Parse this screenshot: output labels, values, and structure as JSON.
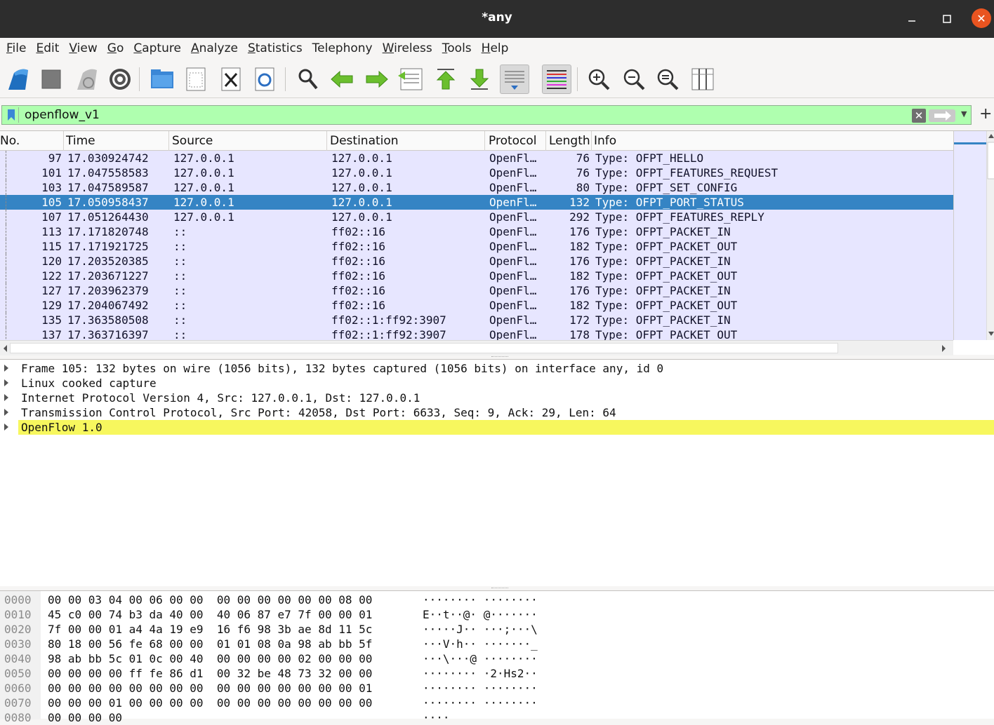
{
  "window": {
    "title": "*any",
    "min_icon": "minimize-icon",
    "max_icon": "maximize-icon",
    "close_icon": "close-icon"
  },
  "menu": [
    {
      "label": "File",
      "u": "F",
      "rest": "ile"
    },
    {
      "label": "Edit",
      "u": "E",
      "rest": "dit"
    },
    {
      "label": "View",
      "u": "V",
      "rest": "iew"
    },
    {
      "label": "Go",
      "u": "G",
      "rest": "o"
    },
    {
      "label": "Capture",
      "u": "C",
      "rest": "apture"
    },
    {
      "label": "Analyze",
      "u": "A",
      "rest": "nalyze"
    },
    {
      "label": "Statistics",
      "u": "S",
      "rest": "tatistics"
    },
    {
      "label": "Telephony",
      "u": "",
      "rest": "Telephony"
    },
    {
      "label": "Wireless",
      "u": "W",
      "rest": "ireless"
    },
    {
      "label": "Tools",
      "u": "T",
      "rest": "ools"
    },
    {
      "label": "Help",
      "u": "H",
      "rest": "elp"
    }
  ],
  "toolbar": [
    "start-capture-icon",
    "stop-capture-icon",
    "restart-capture-icon",
    "capture-options-icon",
    "open-file-icon",
    "save-file-icon",
    "close-file-icon",
    "reload-file-icon",
    "find-packet-icon",
    "go-back-icon",
    "go-forward-icon",
    "go-to-packet-icon",
    "first-packet-icon",
    "last-packet-icon",
    "autoscroll-icon",
    "colorize-icon",
    "zoom-in-icon",
    "zoom-out-icon",
    "normal-size-icon",
    "resize-columns-icon"
  ],
  "filter": {
    "value": "openflow_v1",
    "clear_icon": "clear-filter-icon",
    "apply_icon": "apply-filter-icon",
    "add_label": "+"
  },
  "columns": [
    "No.",
    "Time",
    "Source",
    "Destination",
    "Protocol",
    "Length",
    "Info"
  ],
  "packets": [
    {
      "no": "97",
      "time": "17.030924742",
      "src": "127.0.0.1",
      "dst": "127.0.0.1",
      "proto": "OpenFl…",
      "len": "76",
      "info": "Type: OFPT_HELLO",
      "selected": false
    },
    {
      "no": "101",
      "time": "17.047558583",
      "src": "127.0.0.1",
      "dst": "127.0.0.1",
      "proto": "OpenFl…",
      "len": "76",
      "info": "Type: OFPT_FEATURES_REQUEST",
      "selected": false
    },
    {
      "no": "103",
      "time": "17.047589587",
      "src": "127.0.0.1",
      "dst": "127.0.0.1",
      "proto": "OpenFl…",
      "len": "80",
      "info": "Type: OFPT_SET_CONFIG",
      "selected": false
    },
    {
      "no": "105",
      "time": "17.050958437",
      "src": "127.0.0.1",
      "dst": "127.0.0.1",
      "proto": "OpenFl…",
      "len": "132",
      "info": "Type: OFPT_PORT_STATUS",
      "selected": true
    },
    {
      "no": "107",
      "time": "17.051264430",
      "src": "127.0.0.1",
      "dst": "127.0.0.1",
      "proto": "OpenFl…",
      "len": "292",
      "info": "Type: OFPT_FEATURES_REPLY",
      "selected": false
    },
    {
      "no": "113",
      "time": "17.171820748",
      "src": "::",
      "dst": "ff02::16",
      "proto": "OpenFl…",
      "len": "176",
      "info": "Type: OFPT_PACKET_IN",
      "selected": false
    },
    {
      "no": "115",
      "time": "17.171921725",
      "src": "::",
      "dst": "ff02::16",
      "proto": "OpenFl…",
      "len": "182",
      "info": "Type: OFPT_PACKET_OUT",
      "selected": false
    },
    {
      "no": "120",
      "time": "17.203520385",
      "src": "::",
      "dst": "ff02::16",
      "proto": "OpenFl…",
      "len": "176",
      "info": "Type: OFPT_PACKET_IN",
      "selected": false
    },
    {
      "no": "122",
      "time": "17.203671227",
      "src": "::",
      "dst": "ff02::16",
      "proto": "OpenFl…",
      "len": "182",
      "info": "Type: OFPT_PACKET_OUT",
      "selected": false
    },
    {
      "no": "127",
      "time": "17.203962379",
      "src": "::",
      "dst": "ff02::16",
      "proto": "OpenFl…",
      "len": "176",
      "info": "Type: OFPT_PACKET_IN",
      "selected": false
    },
    {
      "no": "129",
      "time": "17.204067492",
      "src": "::",
      "dst": "ff02::16",
      "proto": "OpenFl…",
      "len": "182",
      "info": "Type: OFPT_PACKET_OUT",
      "selected": false
    },
    {
      "no": "135",
      "time": "17.363580508",
      "src": "::",
      "dst": "ff02::1:ff92:3907",
      "proto": "OpenFl…",
      "len": "172",
      "info": "Type: OFPT_PACKET_IN",
      "selected": false
    },
    {
      "no": "137",
      "time": "17.363716397",
      "src": "::",
      "dst": "ff02::1:ff92:3907",
      "proto": "OpenFl…",
      "len": "178",
      "info": "Type: OFPT_PACKET_OUT",
      "selected": false
    }
  ],
  "details": [
    {
      "text": "Frame 105: 132 bytes on wire (1056 bits), 132 bytes captured (1056 bits) on interface any, id 0",
      "highlight": false
    },
    {
      "text": "Linux cooked capture",
      "highlight": false
    },
    {
      "text": "Internet Protocol Version 4, Src: 127.0.0.1, Dst: 127.0.0.1",
      "highlight": false
    },
    {
      "text": "Transmission Control Protocol, Src Port: 42058, Dst Port: 6633, Seq: 9, Ack: 29, Len: 64",
      "highlight": false
    },
    {
      "text": "OpenFlow 1.0",
      "highlight": true
    }
  ],
  "bytes": [
    {
      "off": "0000",
      "hex": "00 00 03 04 00 06 00 00  00 00 00 00 00 00 08 00",
      "ascii": "········ ········"
    },
    {
      "off": "0010",
      "hex": "45 c0 00 74 b3 da 40 00  40 06 87 e7 7f 00 00 01",
      "ascii": "E··t··@· @·······"
    },
    {
      "off": "0020",
      "hex": "7f 00 00 01 a4 4a 19 e9  16 f6 98 3b ae 8d 11 5c",
      "ascii": "·····J·· ···;···\\"
    },
    {
      "off": "0030",
      "hex": "80 18 00 56 fe 68 00 00  01 01 08 0a 98 ab bb 5f",
      "ascii": "···V·h·· ·······_"
    },
    {
      "off": "0040",
      "hex": "98 ab bb 5c 01 0c 00 40  00 00 00 00 02 00 00 00",
      "ascii": "···\\···@ ········"
    },
    {
      "off": "0050",
      "hex": "00 00 00 00 ff fe 86 d1  00 32 be 48 73 32 00 00",
      "ascii": "········ ·2·Hs2··"
    },
    {
      "off": "0060",
      "hex": "00 00 00 00 00 00 00 00  00 00 00 00 00 00 00 01",
      "ascii": "········ ········"
    },
    {
      "off": "0070",
      "hex": "00 00 00 01 00 00 00 00  00 00 00 00 00 00 00 00",
      "ascii": "········ ········"
    },
    {
      "off": "0080",
      "hex": "00 00 00 00",
      "ascii": "····"
    }
  ]
}
